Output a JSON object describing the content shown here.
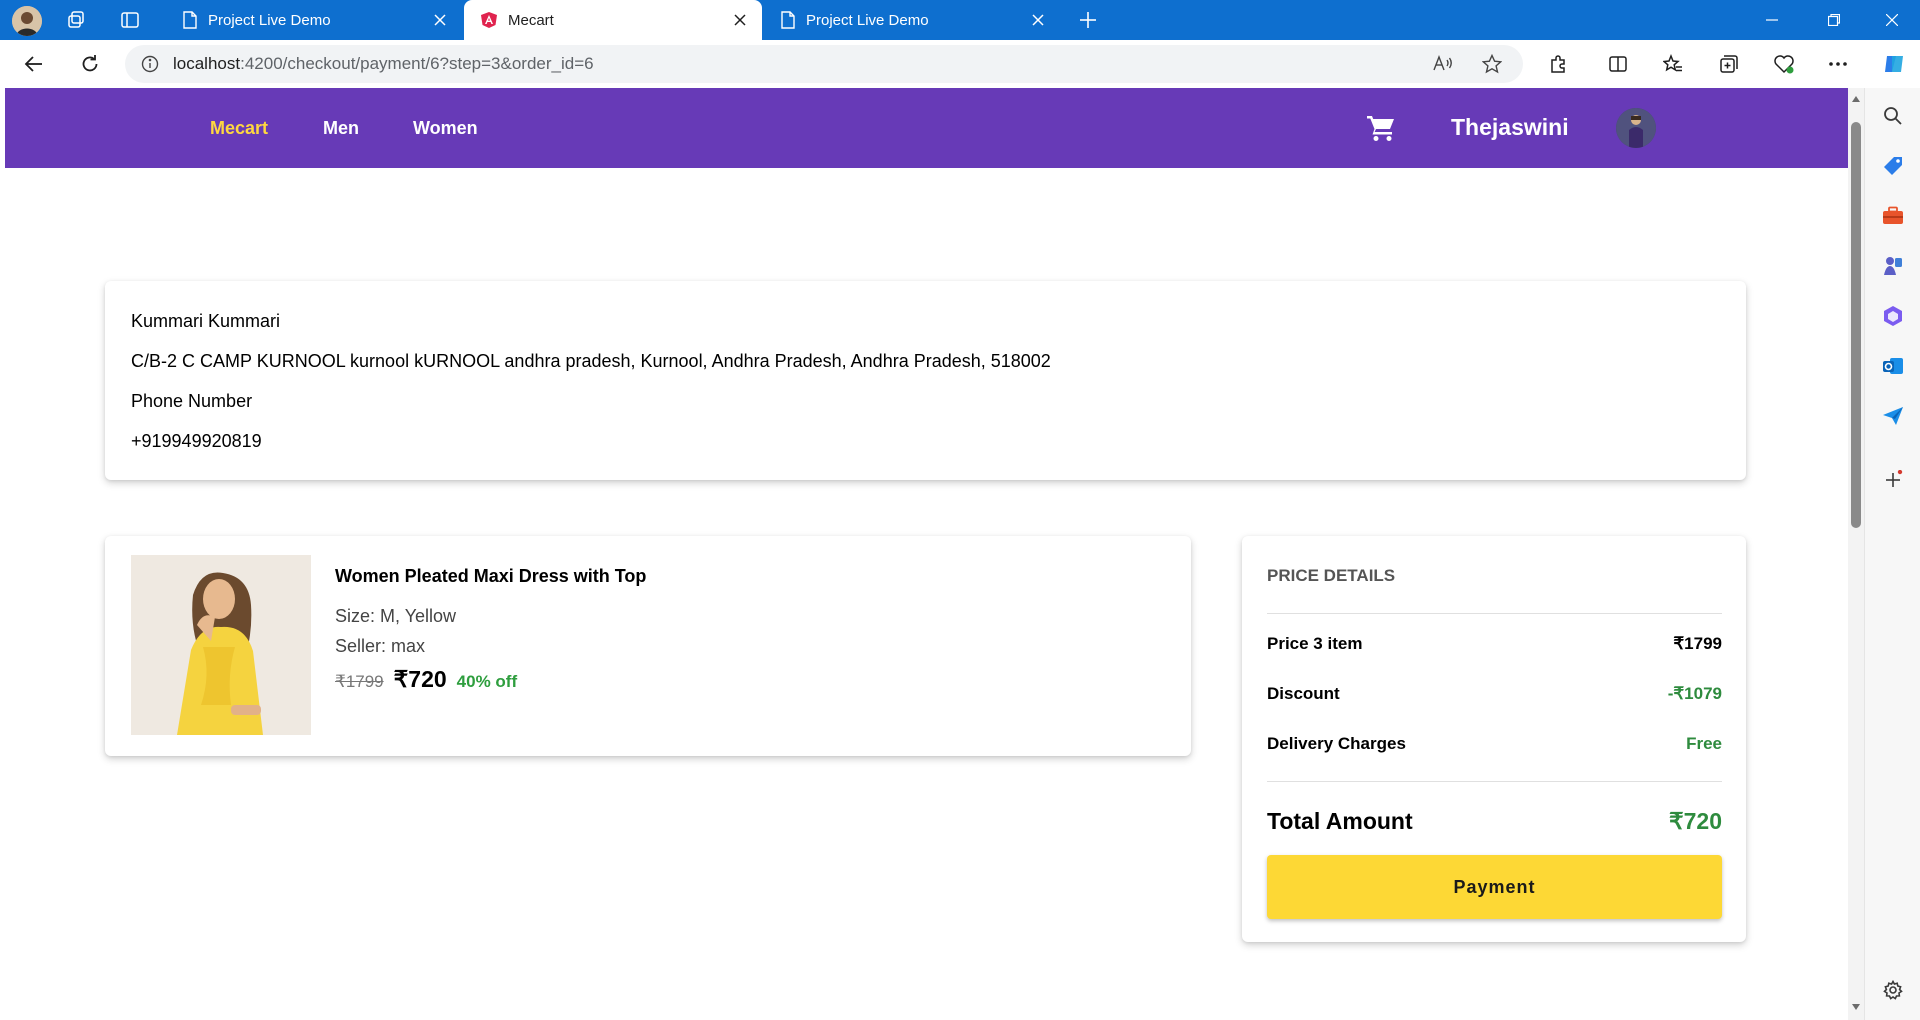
{
  "browser": {
    "tabs": [
      {
        "title": "Project Live Demo",
        "active": false
      },
      {
        "title": "Mecart",
        "active": true
      },
      {
        "title": "Project Live Demo",
        "active": false
      }
    ],
    "url_host": "localhost",
    "url_rest": ":4200/checkout/payment/6?step=3&order_id=6"
  },
  "header": {
    "brand": "Mecart",
    "nav": [
      "Men",
      "Women"
    ],
    "username": "Thejaswini"
  },
  "address": {
    "name": "Kummari Kummari",
    "line": "C/B-2 C CAMP KURNOOL kurnool kURNOOL andhra pradesh, Kurnool, Andhra Pradesh, Andhra Pradesh, 518002",
    "phone_label": "Phone Number",
    "phone": "+919949920819"
  },
  "product": {
    "title": "Women Pleated Maxi Dress with Top",
    "size": "Size: M, Yellow",
    "seller": "Seller: max",
    "old_price": "₹1799",
    "new_price": "₹720",
    "discount": "40% off"
  },
  "price_details": {
    "heading": "PRICE DETAILS",
    "rows": [
      {
        "label": "Price 3 item",
        "value": "₹1799"
      },
      {
        "label": "Discount",
        "value": "-₹1079"
      },
      {
        "label": "Delivery Charges",
        "value": "Free"
      }
    ],
    "total_label": "Total Amount",
    "total_value": "₹720",
    "pay_button": "Payment"
  },
  "colors": {
    "header_bg": "#673ab7",
    "brand": "#ffd740",
    "pay_button": "#fdd835",
    "green": "#2e8b3e",
    "browser_chrome": "#0e6fcf"
  }
}
